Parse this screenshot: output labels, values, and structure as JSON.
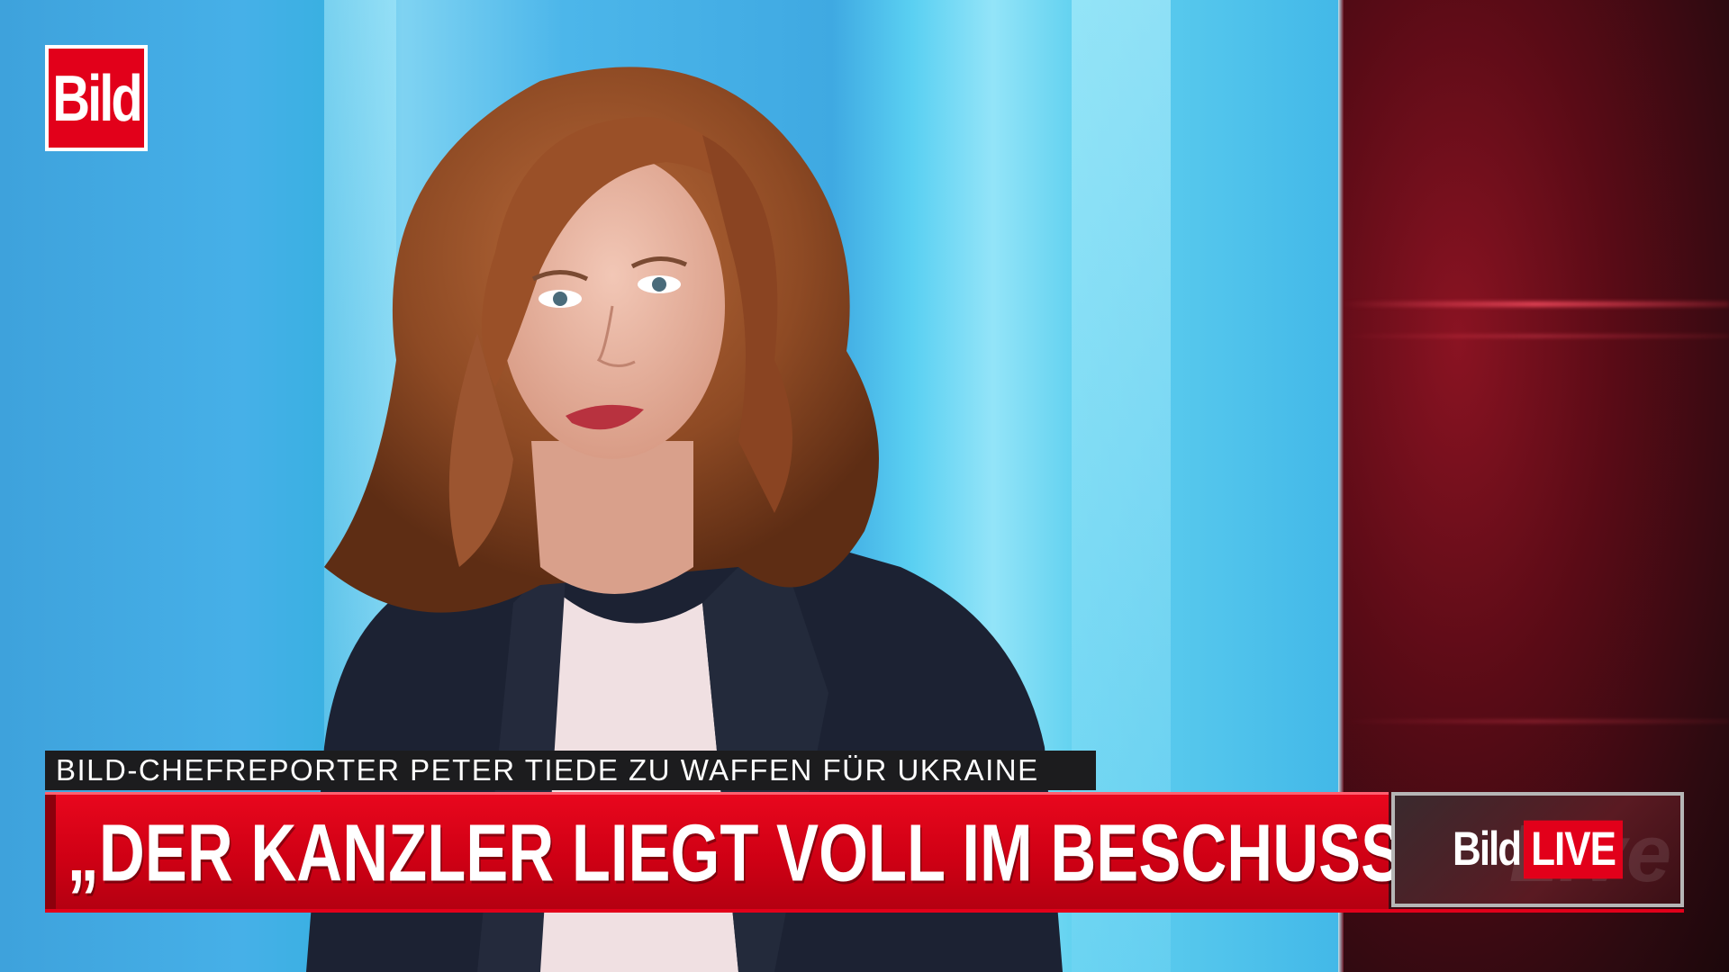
{
  "logo": {
    "text": "Bild"
  },
  "lower_third": {
    "subline": "BILD-CHEFREPORTER PETER TIEDE ZU WAFFEN FÜR UKRAINE",
    "headline": "„DER KANZLER LIEGT VOLL IM BESCHUSS“"
  },
  "live_badge": {
    "brand": "Bild",
    "word": "LIVE",
    "background_word": "Live"
  },
  "colors": {
    "brand_red": "#e2001a",
    "studio_blue": "#3fa9e2",
    "dark_red": "#5a0b16"
  }
}
